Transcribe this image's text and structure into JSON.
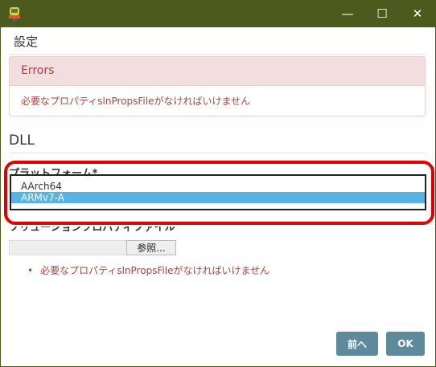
{
  "window": {
    "minimize_glyph": "—",
    "maximize_glyph": "☐",
    "close_glyph": "✕"
  },
  "dialog": {
    "title": "設定"
  },
  "errors": {
    "header": "Errors",
    "message": "必要なプロパティslnPropsFileがなければいけません"
  },
  "section": {
    "title": "DLL"
  },
  "platform": {
    "label": "プラットフォーム*",
    "options": [
      "AArch64",
      "ARMv7-A"
    ],
    "selected": "ARMv7-A"
  },
  "solution_file": {
    "label": "ソリューションプロパティファイル",
    "value": "",
    "browse_label": "参照..."
  },
  "validation": {
    "items": [
      "必要なプロパティslnPropsFileがなければいけません"
    ]
  },
  "buttons": {
    "prev_label": "前へ",
    "ok_label": "OK"
  },
  "colors": {
    "titlebar": "#4d5a1d",
    "error_text": "#a94442",
    "error_header_bg": "#f2dede",
    "selection": "#57b3e2",
    "highlight": "#e00000",
    "button_bg": "#5f8a9c"
  }
}
